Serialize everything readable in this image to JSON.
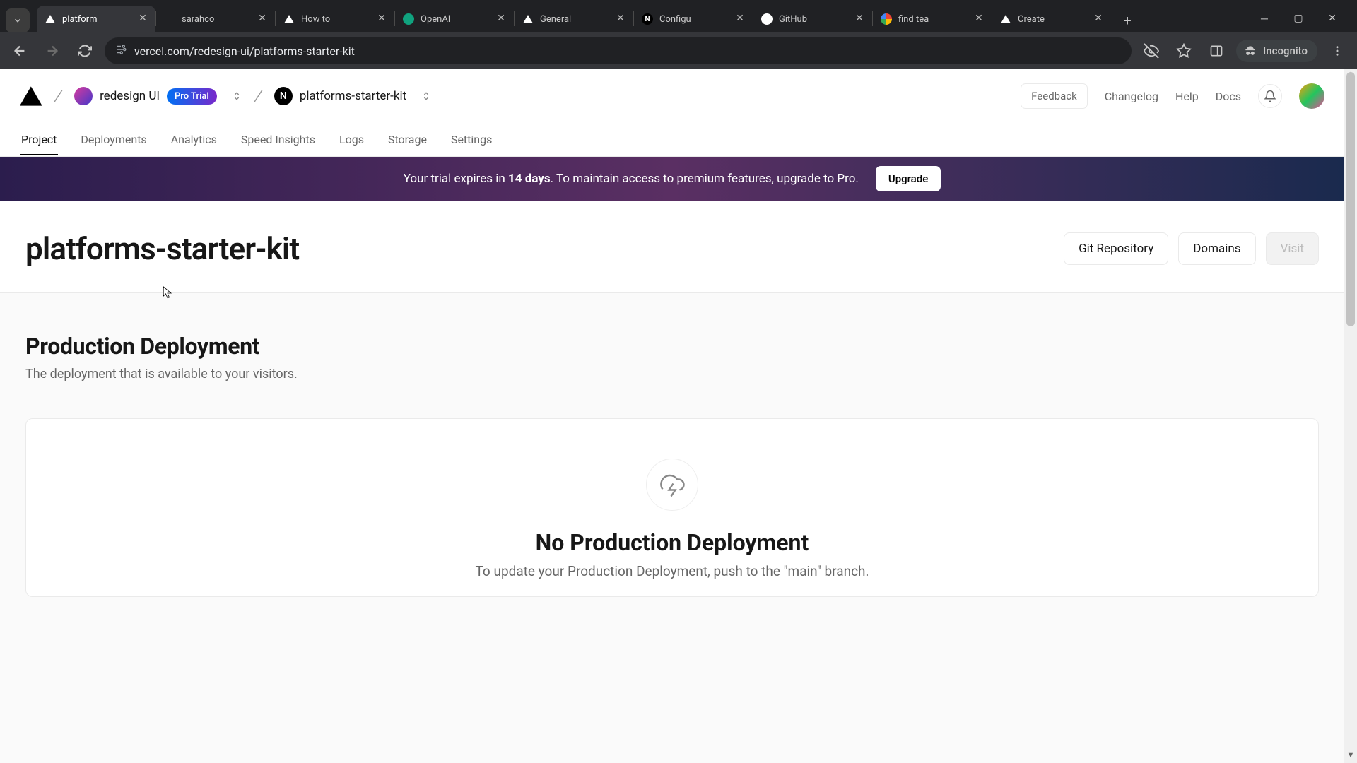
{
  "browser": {
    "tabs": [
      {
        "title": "platform",
        "favicon": "triangle-dark",
        "active": true
      },
      {
        "title": "sarahco",
        "favicon": "none"
      },
      {
        "title": "How to",
        "favicon": "triangle-dark"
      },
      {
        "title": "OpenAI",
        "favicon": "circle-green"
      },
      {
        "title": "General",
        "favicon": "triangle-dark"
      },
      {
        "title": "Configu",
        "favicon": "n-black"
      },
      {
        "title": "GitHub",
        "favicon": "github"
      },
      {
        "title": "find tea",
        "favicon": "google"
      },
      {
        "title": "Create",
        "favicon": "triangle-dark"
      }
    ],
    "url": "vercel.com/redesign-ui/platforms-starter-kit",
    "incognito_label": "Incognito"
  },
  "header": {
    "team": "redesign UI",
    "team_badge": "Pro Trial",
    "project": "platforms-starter-kit",
    "links": {
      "feedback": "Feedback",
      "changelog": "Changelog",
      "help": "Help",
      "docs": "Docs"
    }
  },
  "nav": [
    "Project",
    "Deployments",
    "Analytics",
    "Speed Insights",
    "Logs",
    "Storage",
    "Settings"
  ],
  "nav_active": 0,
  "banner": {
    "pre": "Your trial expires in ",
    "days": "14 days",
    "post": ". To maintain access to premium features, upgrade to Pro.",
    "cta": "Upgrade"
  },
  "project_title": "platforms-starter-kit",
  "actions": {
    "git": "Git Repository",
    "domains": "Domains",
    "visit": "Visit"
  },
  "section": {
    "title": "Production Deployment",
    "subtitle": "The deployment that is available to your visitors.",
    "empty_title": "No Production Deployment",
    "empty_sub": "To update your Production Deployment, push to the \"main\" branch."
  }
}
